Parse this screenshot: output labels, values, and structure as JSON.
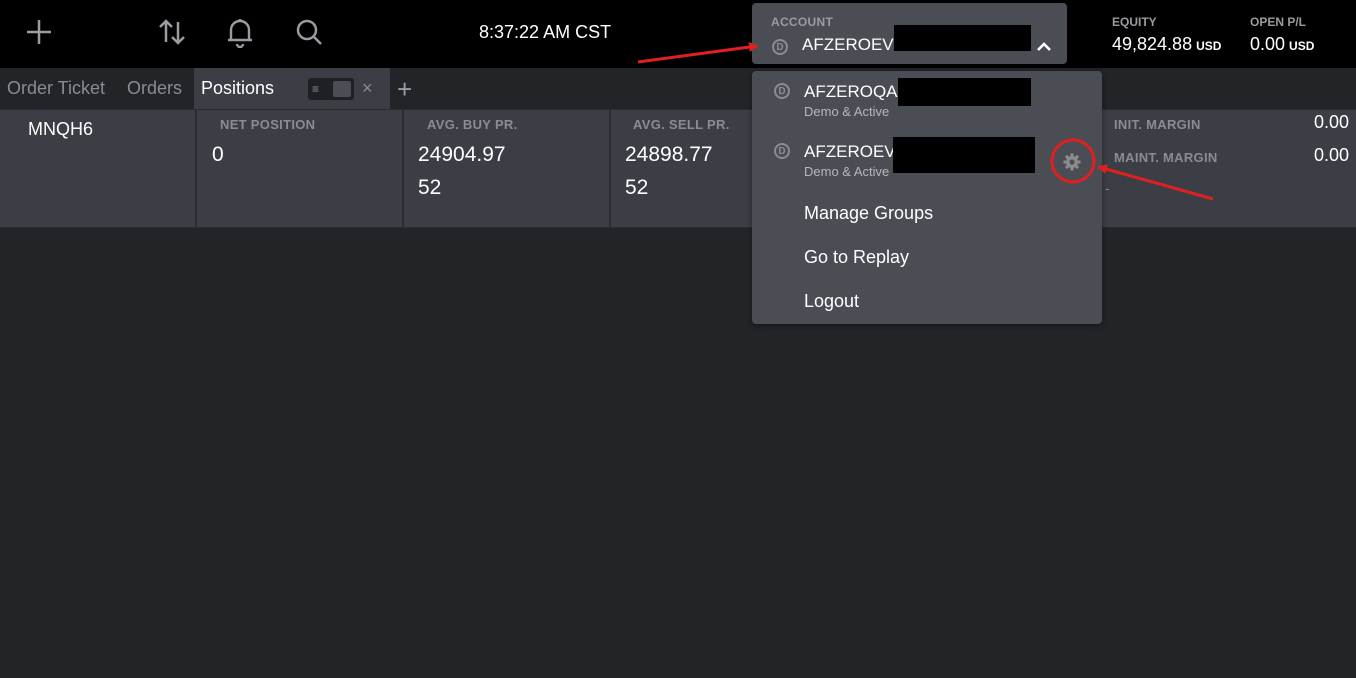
{
  "toolbar": {
    "icons": [
      "plus-icon",
      "arrows-up-down-icon",
      "bell-icon",
      "search-icon"
    ],
    "clock": "8:37:22 AM CST"
  },
  "account": {
    "label": "ACCOUNT",
    "badge": "D",
    "name": "AFZEROEV",
    "chevron": "chevron-up-icon"
  },
  "equity": {
    "label": "EQUITY",
    "value": "49,824.88",
    "unit": "USD"
  },
  "open_pl": {
    "label": "OPEN P/L",
    "value": "0.00",
    "unit": "USD"
  },
  "tabs": {
    "items": [
      {
        "label": "Order Ticket"
      },
      {
        "label": "Orders"
      },
      {
        "label": "Positions"
      }
    ],
    "lines_glyph": "≡",
    "close_glyph": "×",
    "add_glyph": "+"
  },
  "position": {
    "symbol": "MNQH6",
    "columns": [
      {
        "header": "NET POSITION",
        "value": "0",
        "value2": ""
      },
      {
        "header": "AVG. BUY PR.",
        "value": "24904.97",
        "value2": "52"
      },
      {
        "header": "AVG. SELL PR.",
        "value": "24898.77",
        "value2": "52"
      }
    ],
    "init_margin": {
      "label": "INIT. MARGIN",
      "value": "0.00"
    },
    "maint_margin": {
      "label": "MAINT. MARGIN",
      "value": "0.00"
    },
    "dash": "-"
  },
  "dropdown": {
    "accounts": [
      {
        "name": "AFZEROQA",
        "sub": "Demo & Active",
        "badge": "D"
      },
      {
        "name": "AFZEROEV",
        "sub": "Demo & Active",
        "badge": "D",
        "action_icon": "gear-icon"
      }
    ],
    "menu": [
      {
        "label": "Manage Groups"
      },
      {
        "label": "Go to Replay"
      },
      {
        "label": "Logout"
      }
    ]
  },
  "colors": {
    "accent_annotation": "#e02020",
    "panel": "#4a4d54",
    "background": "#232428",
    "topbar": "#000000"
  }
}
